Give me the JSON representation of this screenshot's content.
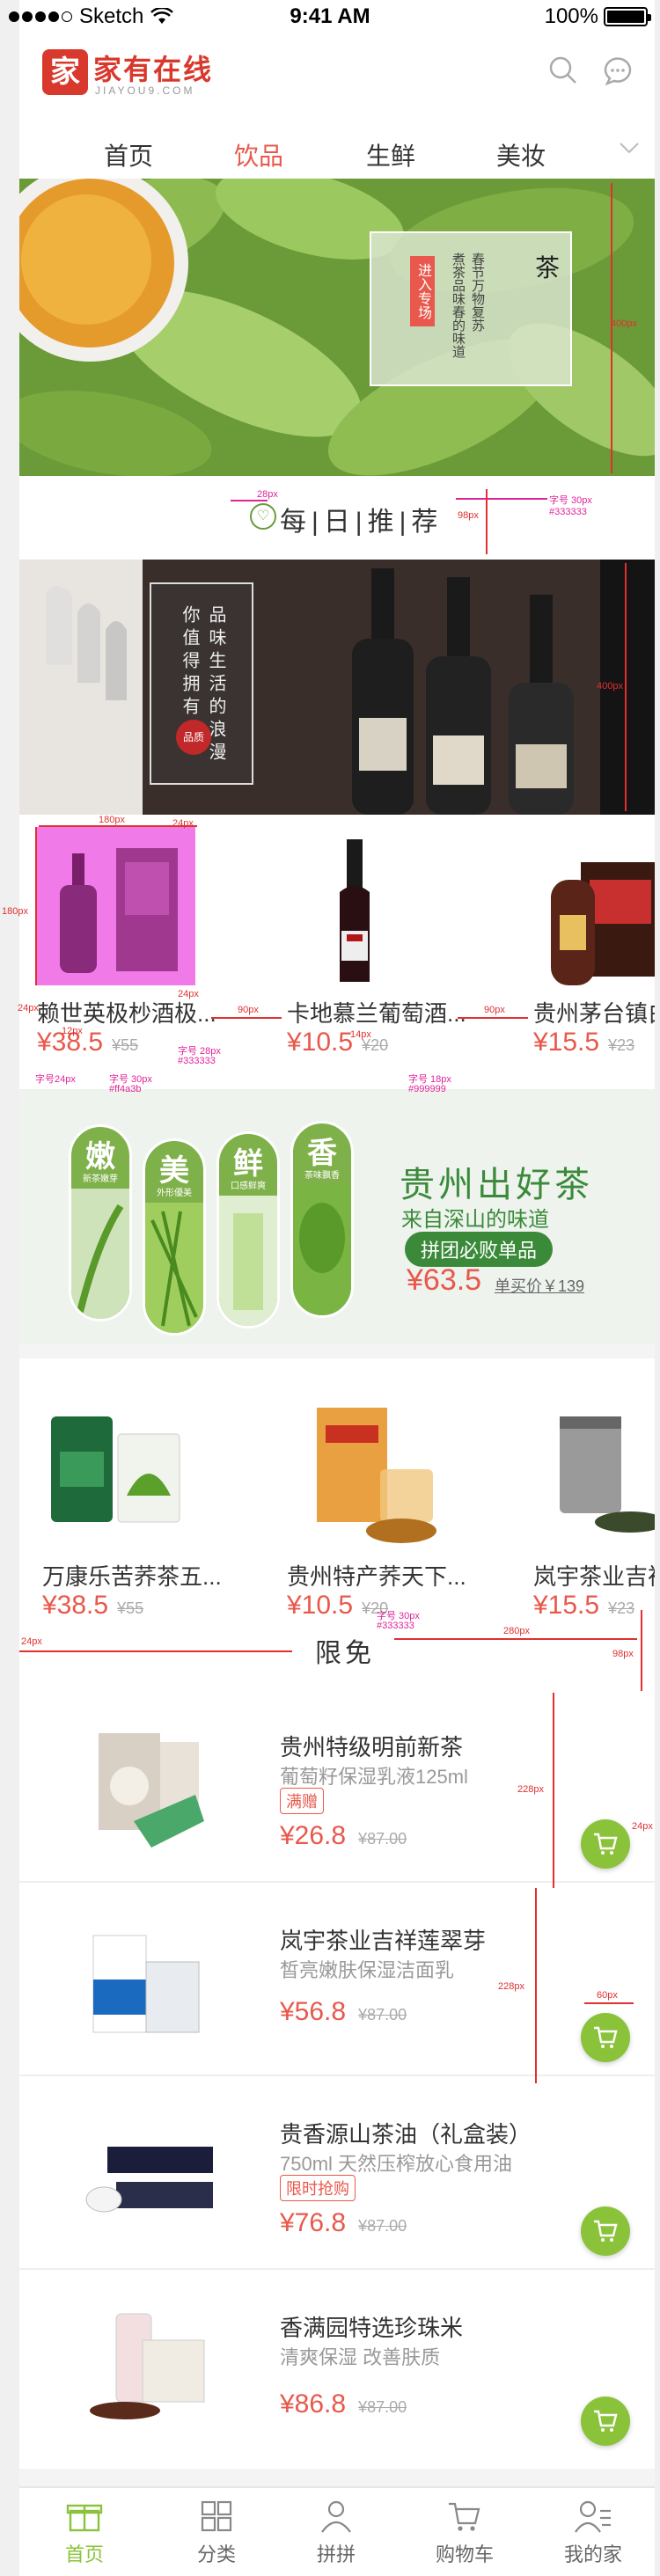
{
  "status_bar": {
    "carrier": "Sketch",
    "time": "9:41 AM",
    "battery": "100%"
  },
  "header": {
    "logo_mark": "家",
    "logo_text": "家有在线",
    "logo_sub": "JIAYOU9.COM",
    "icons": [
      "search-icon",
      "chat-icon"
    ]
  },
  "tabs": {
    "items": [
      "首页",
      "饮品",
      "生鲜",
      "美妆"
    ],
    "active": "饮品"
  },
  "banner1": {
    "badge": "进入专场",
    "title": "茶",
    "verse": [
      "春节万物复苏",
      "煮茶品味春的味道"
    ]
  },
  "daily": {
    "title": "每|日|推|荐"
  },
  "banner2": {
    "lines": [
      "品味生活的浪漫",
      "你值得拥有"
    ],
    "seal": "品质"
  },
  "row1": [
    {
      "name": "赖世英极杪酒极...",
      "price": "¥38.5",
      "orig": "¥55"
    },
    {
      "name": "卡地慕兰葡萄酒...",
      "price": "¥10.5",
      "orig": "¥20"
    },
    {
      "name": "贵州茅台镇白",
      "price": "¥15.5",
      "orig": "¥23"
    }
  ],
  "promo": {
    "pills": [
      {
        "char": "嫩",
        "sub": "新茶嫩芽"
      },
      {
        "char": "美",
        "sub": "外形優美"
      },
      {
        "char": "鲜",
        "sub": "口感鲜爽"
      },
      {
        "char": "香",
        "sub": "茶味飘香"
      }
    ],
    "title": "贵州出好茶",
    "subtitle": "来自深山的味道",
    "button": "拼团必败单品",
    "price": "¥63.5",
    "unit_price": "单买价￥139"
  },
  "row2": [
    {
      "name": "万康乐苦荞茶五...",
      "price": "¥38.5",
      "orig": "¥55"
    },
    {
      "name": "贵州特产荞天下...",
      "price": "¥10.5",
      "orig": "¥20"
    },
    {
      "name": "岚宇茶业吉祥",
      "price": "¥15.5",
      "orig": "¥23"
    }
  ],
  "xianmian": {
    "title": "限免"
  },
  "list": [
    {
      "title": "贵州特级明前新茶",
      "desc": "葡萄籽保湿乳液125ml",
      "tag": "满赠",
      "price": "¥26.8",
      "orig": "¥87.00"
    },
    {
      "title": "岚宇茶业吉祥莲翠芽",
      "desc": "皙亮嫩肤保湿洁面乳",
      "tag": "",
      "price": "¥56.8",
      "orig": "¥87.00"
    },
    {
      "title": "贵香源山茶油（礼盒装）",
      "desc": "750ml 天然压榨放心食用油",
      "tag": "限时抢购",
      "price": "¥76.8",
      "orig": "¥87.00"
    },
    {
      "title": "香满园特选珍珠米",
      "desc": "清爽保湿 改善肤质",
      "tag": "",
      "price": "¥86.8",
      "orig": "¥87.00"
    }
  ],
  "tabbar": {
    "items": [
      "首页",
      "分类",
      "拼拼",
      "购物车",
      "我的家"
    ],
    "active": "首页"
  },
  "annotations": {
    "a1": "28px",
    "a2": "字号 30px",
    "a3": "#333333",
    "a4": "98px",
    "a5": "400px",
    "a6": "180px",
    "a7": "24px",
    "a8": "180px",
    "a9": "24px",
    "a10": "24px",
    "a11": "90px",
    "a12": "90px",
    "a13": "12px",
    "a14": "字号 28px",
    "a15": "#333333",
    "a16": "14px",
    "a17": "字号24px",
    "a18": "字号 30px",
    "a19": "#ff4a3b",
    "a20": "字号 18px",
    "a21": "#999999",
    "a22": "24px",
    "a23": "字号 30px",
    "a24": "#333333",
    "a25": "280px",
    "a26": "98px",
    "a27": "228px",
    "a28": "24px",
    "a29": "228px",
    "a30": "60px"
  },
  "colors": {
    "accent": "#e8584c",
    "green": "#8ac33a",
    "text": "#333333"
  }
}
